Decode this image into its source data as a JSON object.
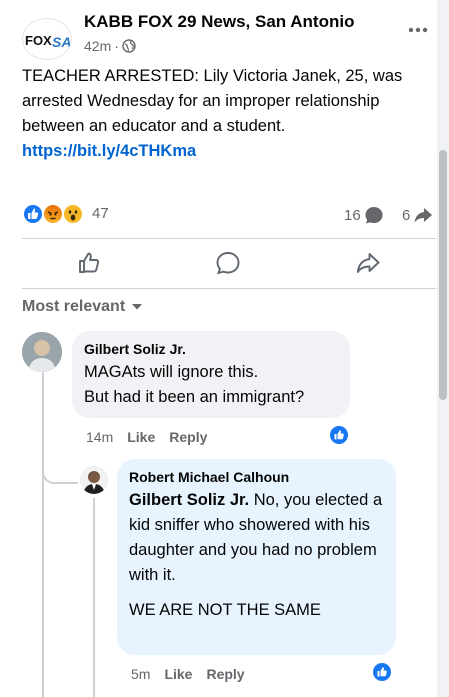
{
  "post": {
    "page_name": "KABB FOX 29 News, San Antonio",
    "timestamp": "42m",
    "logo_text": "FOX",
    "logo_accent": "SA",
    "text": "TEACHER ARRESTED: Lily Victoria Janek, 25, was arrested Wednesday for an improper relationship between an educator and a student.",
    "link": "https://bit.ly/4cTHKma",
    "more_icon": "more-horizontal-icon",
    "privacy_icon": "globe-icon"
  },
  "stats": {
    "reactions": [
      "like",
      "angry",
      "wow"
    ],
    "reaction_count": "47",
    "comment_count": "16",
    "share_count": "6"
  },
  "actions": {
    "like_icon": "thumbs-up-icon",
    "comment_icon": "comment-bubble-icon",
    "share_icon": "share-arrow-icon"
  },
  "comments_header": {
    "sort_label": "Most relevant"
  },
  "comments": [
    {
      "author": "Gilbert Soliz Jr.",
      "lines": [
        "MAGAts will ignore this.",
        "But had it been an immigrant?"
      ],
      "time": "14m",
      "like_label": "Like",
      "reply_label": "Reply"
    }
  ],
  "reply": {
    "author": "Robert Michael Calhoun",
    "mention": "Gilbert Soliz Jr.",
    "text": " No, you elected a kid sniffer who showered with his daughter and you had no problem with it.",
    "text2": "WE ARE NOT THE SAME",
    "time": "5m",
    "like_label": "Like",
    "reply_label": "Reply"
  },
  "colors": {
    "accent": "#1877f2",
    "link": "#0064d1",
    "secondary_text": "#65676b",
    "bubble": "#f0f2f5",
    "reply_bubble": "#e7f3ff"
  }
}
